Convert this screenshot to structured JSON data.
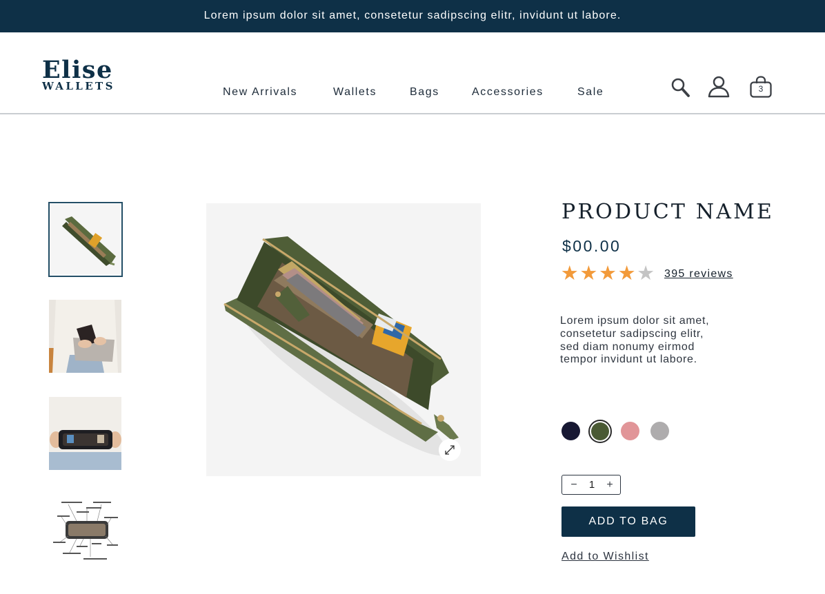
{
  "announcement": "Lorem ipsum dolor sit amet, consetetur sadipscing elitr, invidunt ut labore.",
  "brand": {
    "name": "Elise",
    "subtitle": "WALLETS"
  },
  "nav": [
    "New Arrivals",
    "Wallets",
    "Bags",
    "Accessories",
    "Sale"
  ],
  "header_icons": {
    "search": "search-icon",
    "account": "user-icon",
    "cart": "shopping-bag-icon",
    "cart_count": "3"
  },
  "product": {
    "name": "PRODUCT NAME",
    "price": "$00.00",
    "rating": 4,
    "rating_max": 5,
    "reviews_label": "395 reviews",
    "description": "Lorem ipsum dolor sit amet, consetetur sadipscing elitr, sed diam nonumy eirmod tempor invidunt ut labore.",
    "swatches": [
      {
        "color": "#171833",
        "selected": false
      },
      {
        "color": "#4a5a34",
        "selected": true
      },
      {
        "color": "#e19598",
        "selected": false
      },
      {
        "color": "#aeacad",
        "selected": false
      }
    ],
    "quantity": "1",
    "qty_minus": "−",
    "qty_plus": "+",
    "add_to_bag": "ADD TO BAG",
    "wishlist": "Add to Wishlist"
  },
  "thumbnails": [
    "open-wallet-thumbnail",
    "wallet-in-hands-thumbnail",
    "open-wallet-top-view-thumbnail",
    "wallet-diagram-thumbnail"
  ],
  "colors": {
    "primary": "#0e3047",
    "star_filled": "#f29a3a",
    "star_empty": "#c4c4c4",
    "thumb_selected_border": "#234e66"
  }
}
